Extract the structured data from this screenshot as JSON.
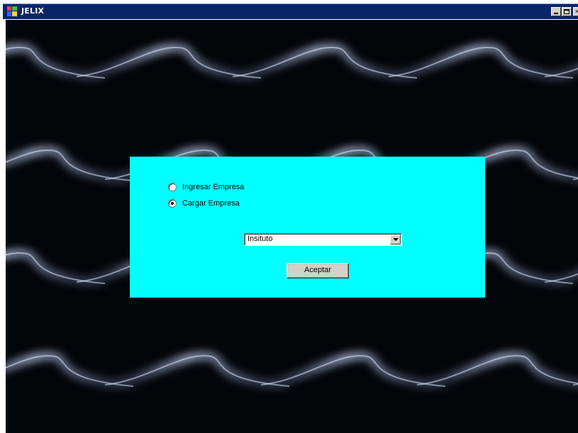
{
  "window": {
    "title": "JELIX",
    "icon": "app-icon",
    "controls": {
      "minimize": "minimize-icon",
      "maximize": "maximize-icon",
      "close": "close-icon"
    }
  },
  "dialog": {
    "background_color": "#00ffff",
    "options": [
      {
        "label": "Ingresar Empresa",
        "selected": false
      },
      {
        "label": "Cargar Empresa",
        "selected": true
      }
    ],
    "combo": {
      "value": "Insituto"
    },
    "accept_label": "Aceptar"
  },
  "colors": {
    "titlebar": "#0a246a",
    "desktop_background": "#02050a",
    "streak": "#9ab4e6"
  }
}
